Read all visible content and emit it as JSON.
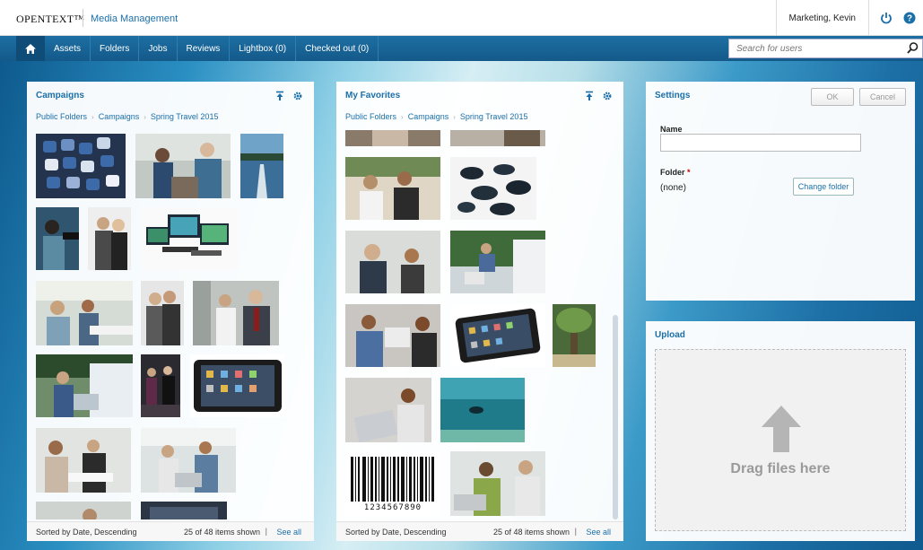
{
  "header": {
    "brand": "OPENTEXT™",
    "product": "Media Management",
    "user": "Marketing, Kevin",
    "icons": [
      "power-icon",
      "help-icon"
    ]
  },
  "nav": {
    "home_icon": "home-icon",
    "items": [
      "Assets",
      "Folders",
      "Jobs",
      "Reviews",
      "Lightbox (0)",
      "Checked out (0)"
    ],
    "search_placeholder": "Search for users"
  },
  "campaigns": {
    "title": "Campaigns",
    "breadcrumb": [
      "Public Folders",
      "Campaigns",
      "Spring Travel 2015"
    ],
    "icons": [
      "upload-icon",
      "gear-icon"
    ],
    "sort": "Sorted by Date, Descending",
    "count": "25 of 48 items shown",
    "see_all": "See all",
    "thumbnails": [
      "smartphone-app-icons",
      "business-meeting",
      "lake-pier",
      "woman-on-phone",
      "businesswoman-portrait",
      "computer-monitors",
      "team-meeting",
      "business-couple",
      "doctor-and-businessman",
      "office-workers",
      "nightclub-crowd",
      "tablet-device",
      "office-desk-meeting",
      "laptop-collaboration",
      "extra-thumb"
    ]
  },
  "favorites": {
    "title": "My Favorites",
    "breadcrumb": [
      "Public Folders",
      "Campaigns",
      "Spring Travel 2015"
    ],
    "icons": [
      "upload-icon",
      "gear-icon"
    ],
    "sort": "Sorted by Date, Descending",
    "count": "25 of 48 items shown",
    "see_all": "See all",
    "barcode_number": "1234567890",
    "thumbnails": [
      "partial-top-1",
      "partial-top-2",
      "smiling-colleagues",
      "black-stones",
      "business-partners",
      "laptop-team",
      "laptop-man",
      "android-tablet",
      "tropical-tree",
      "woman-with-laptop",
      "underwater-diver",
      "barcode",
      "men-at-laptop"
    ]
  },
  "settings": {
    "title": "Settings",
    "ok_label": "OK",
    "cancel_label": "Cancel",
    "name_label": "Name",
    "name_value": "",
    "folder_label": "Folder",
    "required_mark": "*",
    "folder_value": "(none)",
    "change_folder_label": "Change folder"
  },
  "upload": {
    "title": "Upload",
    "drop_text": "Drag files here",
    "icon": "arrow-up-icon"
  },
  "colors": {
    "accent": "#1b6fa8",
    "nav_bg": "#1d6fa3"
  }
}
